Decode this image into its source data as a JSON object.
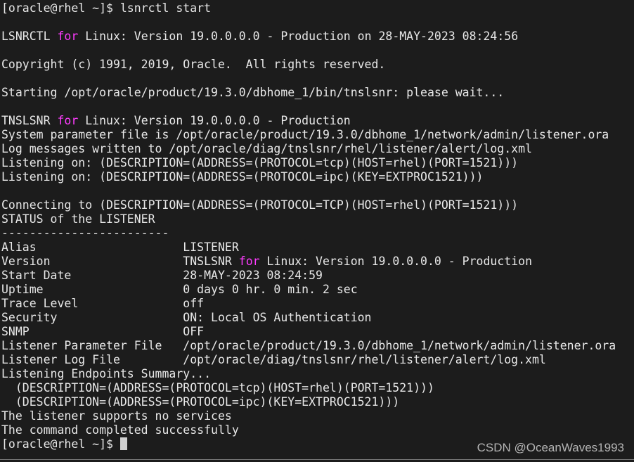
{
  "terminal": {
    "lines": [
      [
        {
          "t": "[oracle@rhel ~]$ lsnrctl start"
        }
      ],
      [],
      [
        {
          "t": "LSNRCTL "
        },
        {
          "t": "for",
          "k": 1
        },
        {
          "t": " Linux: Version 19.0.0.0.0 - Production on 28-MAY-2023 08:24:56"
        }
      ],
      [],
      [
        {
          "t": "Copyright (c) 1991, 2019, Oracle.  All rights reserved."
        }
      ],
      [],
      [
        {
          "t": "Starting /opt/oracle/product/19.3.0/dbhome_1/bin/tnslsnr: please wait..."
        }
      ],
      [],
      [
        {
          "t": "TNSLSNR "
        },
        {
          "t": "for",
          "k": 1
        },
        {
          "t": " Linux: Version 19.0.0.0.0 - Production"
        }
      ],
      [
        {
          "t": "System parameter file is /opt/oracle/product/19.3.0/dbhome_1/network/admin/listener.ora"
        }
      ],
      [
        {
          "t": "Log messages written to /opt/oracle/diag/tnslsnr/rhel/listener/alert/log.xml"
        }
      ],
      [
        {
          "t": "Listening on: (DESCRIPTION=(ADDRESS=(PROTOCOL=tcp)(HOST=rhel)(PORT=1521)))"
        }
      ],
      [
        {
          "t": "Listening on: (DESCRIPTION=(ADDRESS=(PROTOCOL=ipc)(KEY=EXTPROC1521)))"
        }
      ],
      [],
      [
        {
          "t": "Connecting to (DESCRIPTION=(ADDRESS=(PROTOCOL=TCP)(HOST=rhel)(PORT=1521)))"
        }
      ],
      [
        {
          "t": "STATUS of the LISTENER"
        }
      ],
      [
        {
          "t": "------------------------"
        }
      ],
      [
        {
          "t": "Alias                     LISTENER"
        }
      ],
      [
        {
          "t": "Version                   TNSLSNR "
        },
        {
          "t": "for",
          "k": 1
        },
        {
          "t": " Linux: Version 19.0.0.0.0 - Production"
        }
      ],
      [
        {
          "t": "Start Date                28-MAY-2023 08:24:59"
        }
      ],
      [
        {
          "t": "Uptime                    0 days 0 hr. 0 min. 2 sec"
        }
      ],
      [
        {
          "t": "Trace Level               off"
        }
      ],
      [
        {
          "t": "Security                  ON: Local OS Authentication"
        }
      ],
      [
        {
          "t": "SNMP                      OFF"
        }
      ],
      [
        {
          "t": "Listener Parameter File   /opt/oracle/product/19.3.0/dbhome_1/network/admin/listener.ora"
        }
      ],
      [
        {
          "t": "Listener Log File         /opt/oracle/diag/tnslsnr/rhel/listener/alert/log.xml"
        }
      ],
      [
        {
          "t": "Listening Endpoints Summary..."
        }
      ],
      [
        {
          "t": "  (DESCRIPTION=(ADDRESS=(PROTOCOL=tcp)(HOST=rhel)(PORT=1521)))"
        }
      ],
      [
        {
          "t": "  (DESCRIPTION=(ADDRESS=(PROTOCOL=ipc)(KEY=EXTPROC1521)))"
        }
      ],
      [
        {
          "t": "The listener supports no services"
        }
      ],
      [
        {
          "t": "The command completed successfully"
        }
      ],
      [
        {
          "t": "[oracle@rhel ~]$ "
        }
      ]
    ],
    "keyword_color": "#ff3cff",
    "background": "#1c1c1c",
    "foreground": "#e8e8e8"
  },
  "watermark": "CSDN @OceanWaves1993"
}
